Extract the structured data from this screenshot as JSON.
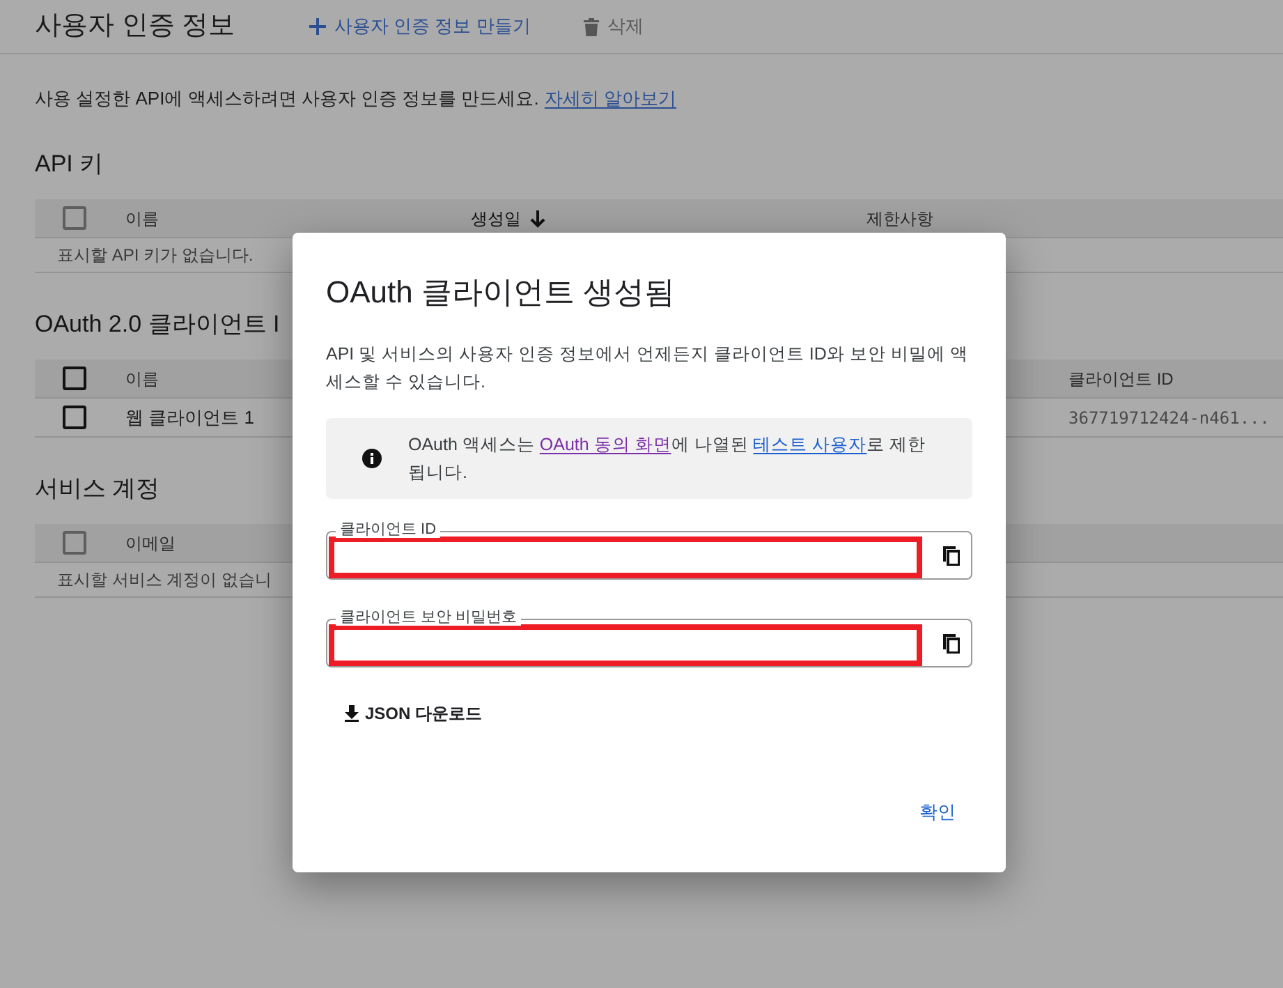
{
  "header": {
    "title": "사용자 인증 정보",
    "actions": [
      {
        "kind": "create",
        "label": "사용자 인증 정보 만들기"
      },
      {
        "kind": "delete",
        "label": "삭제"
      }
    ]
  },
  "intro": {
    "text": "사용 설정한 API에 액세스하려면 사용자 인증 정보를 만드세요.",
    "link": "자세히 알아보기"
  },
  "sections": [
    {
      "title": "API 키",
      "header_checkbox": {
        "checked": false,
        "disabled": true
      },
      "columns": [
        {
          "label": "이름",
          "sorted": false
        },
        {
          "label": "생성일",
          "sorted": true
        },
        {
          "label": "제한사항",
          "sorted": false
        }
      ],
      "empty_message": "표시할 API 키가 없습니다."
    },
    {
      "title": "OAuth 2.0 클라이언트 I",
      "header_checkbox": {
        "checked": false,
        "disabled": false
      },
      "columns": [
        {
          "label": "이름",
          "sorted": false
        },
        {
          "label": "클라이언트 ID",
          "sorted": false
        }
      ],
      "rows": [
        {
          "checked": false,
          "cells": [
            "웹 클라이언트 1",
            "367719712424-n461..."
          ]
        }
      ]
    },
    {
      "title": "서비스 계정",
      "header_checkbox": {
        "checked": false,
        "disabled": true
      },
      "columns": [
        {
          "label": "이메일",
          "sorted": false
        }
      ],
      "empty_message": "표시할 서비스 계정이 없습니"
    }
  ],
  "dialog": {
    "title": "OAuth 클라이언트 생성됨",
    "description": "API 및 서비스의 사용자 인증 정보에서 언제든지 클라이언트 ID와 보안 비밀에 액세스할 수 있습니다.",
    "notice": {
      "before": "OAuth 액세스는 ",
      "link_1": "OAuth 동의 화면",
      "middle": "에 나열된 ",
      "link_2": "테스트 사용자",
      "after": "로 제한됩니다."
    },
    "fields": [
      {
        "label": "클라이언트 ID",
        "redacted": true
      },
      {
        "label": "클라이언트 보안 비밀번호",
        "redacted": true
      }
    ],
    "download_button": "JSON 다운로드",
    "confirm_button": "확인"
  }
}
